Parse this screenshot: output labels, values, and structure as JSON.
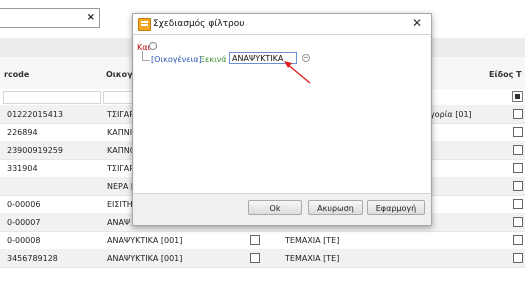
{
  "search": {
    "value": "",
    "clear_glyph": "×"
  },
  "grid": {
    "columns": {
      "barcode": "rcode",
      "family": "Οικογ",
      "item_type": "Είδος Τ"
    },
    "rows": [
      {
        "barcode": "01222015413",
        "family": "ΤΣΙΓΑΡ",
        "extra": "γορία [01]"
      },
      {
        "barcode": "226894",
        "family": "ΚΑΠΝΙ",
        "extra": ""
      },
      {
        "barcode": "23900919259",
        "family": "ΚΑΠΝΟ",
        "extra": ""
      },
      {
        "barcode": "331904",
        "family": "ΤΣΙΓΑΡ",
        "extra": ""
      },
      {
        "barcode": "",
        "family": "ΝΕΡΑ [",
        "extra": ""
      },
      {
        "barcode": "0-00006",
        "family": "ΕΙΣΙΤΗ",
        "extra": ""
      },
      {
        "barcode": "0-00007",
        "family": "ΑΝΑΨ",
        "extra": ""
      },
      {
        "barcode": "0-00008",
        "family": "ΑΝΑΨΥΚΤΙΚΑ [001]",
        "unit": "ΤΕΜΑΧΙΑ [ΤΕ]"
      },
      {
        "barcode": "3456789128",
        "family": "ΑΝΑΨΥΚΤΙΚΑ [001]",
        "unit": "ΤΕΜΑΧΙΑ [ΤΕ]"
      }
    ]
  },
  "dialog": {
    "title": "Σχεδιασμός φίλτρου",
    "close_glyph": "✕",
    "group_operator": "Και",
    "condition": {
      "field": "[Οικογένεια]",
      "operator": "Ξεκινά με",
      "value": "ΑΝΑΨΥΚΤΙΚΑ"
    },
    "buttons": {
      "ok": "Ok",
      "cancel": "Ακυρωση",
      "apply": "Εφαρμογή"
    }
  },
  "colors": {
    "group_operator": "#c00000",
    "field": "#2a56b8",
    "operator": "#3d8f2a",
    "arrow": "#e02020"
  },
  "icons": {
    "title": "filter-design-icon",
    "add": "add-condition-icon",
    "remove": "remove-condition-icon"
  }
}
